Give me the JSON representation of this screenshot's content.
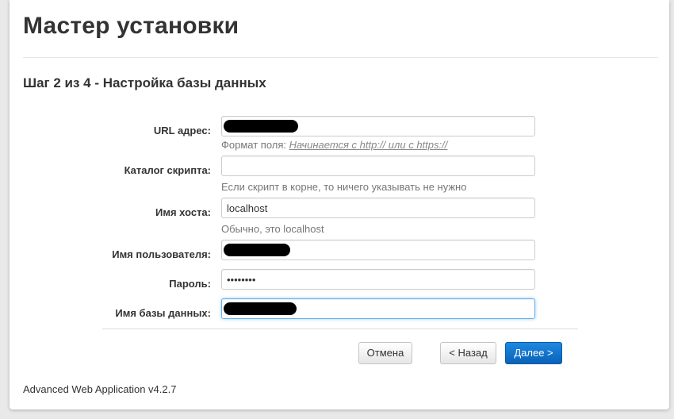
{
  "app_title": "Мастер установки",
  "step_title": "Шаг 2 из 4 - Настройка базы данных",
  "form": {
    "url": {
      "label": "URL адрес:",
      "help_prefix": "Формат поля:",
      "help_example": "Начинается с http:// или с https://"
    },
    "script_dir": {
      "label": "Каталог скрипта:",
      "value": "",
      "help": "Если скрипт в корне, то ничего указывать не нужно"
    },
    "host": {
      "label": "Имя хоста:",
      "value": "localhost",
      "help": "Обычно, это localhost"
    },
    "username": {
      "label": "Имя пользователя:"
    },
    "password": {
      "label": "Пароль:",
      "value": "••••••••"
    },
    "db_name": {
      "label": "Имя базы данных:"
    }
  },
  "buttons": {
    "cancel": "Отмена",
    "back": "< Назад",
    "next": "Далее >"
  },
  "footer": "Advanced Web Application v4.2.7",
  "colors": {
    "primary": "#0a62b8",
    "focus_border": "#66afe9",
    "redaction": "#000000"
  }
}
